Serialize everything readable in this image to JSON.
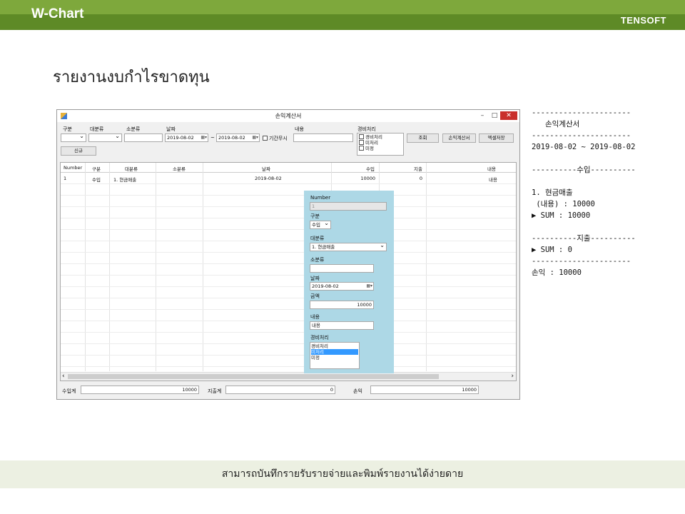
{
  "header": {
    "brand": "W-Chart",
    "company": "TENSOFT"
  },
  "page_title": "รายงานงบกำไรขาดทุน",
  "footer_text": "สามารถบันทึกรายรับรายจ่ายและพิมพ์รายงานได้ง่ายดาย",
  "window": {
    "title": "손익계산서",
    "minimize": "–",
    "maximize": "□",
    "close": "✕",
    "filters": {
      "type_label": "구분",
      "major_label": "대분류",
      "minor_label": "소분류",
      "date_label": "날짜",
      "date_from": "2019-08-02",
      "tilde": "~",
      "date_to": "2019-08-02",
      "ignore_period_label": "기간무시",
      "memo_label": "내용",
      "expense_label": "경비처리",
      "expense_options": [
        "경비처리",
        "미처리",
        "미정"
      ]
    },
    "buttons": {
      "new": "신규",
      "search": "조회",
      "income_statement": "손익계산서",
      "excel_save": "엑셀저장"
    },
    "grid": {
      "columns": [
        "Number",
        "구분",
        "대분류",
        "소분류",
        "날짜",
        "수입",
        "지출",
        "내용"
      ],
      "rows": [
        {
          "number": "1",
          "type": "수입",
          "major": "1. 현금매출",
          "minor": "",
          "date": "2019-08-02",
          "income": "10000",
          "expense": "0",
          "memo": "내용"
        }
      ],
      "scroll_left": "‹",
      "scroll_right": "›"
    },
    "totals": {
      "income_label": "수입계",
      "income_value": "10000",
      "expense_label": "지출계",
      "expense_value": "0",
      "profit_label": "손익",
      "profit_value": "10000"
    }
  },
  "dialog": {
    "number_label": "Number",
    "number_value": "1",
    "type_label": "구분",
    "type_value": "수입",
    "major_label": "대분류",
    "major_value": "1. 현금매출",
    "minor_label": "소분류",
    "minor_value": "",
    "date_label": "날짜",
    "date_value": "2019-08-02",
    "amount_label": "금액",
    "amount_value": "10000",
    "memo_label": "내용",
    "memo_value": "내용",
    "expense_label": "경비처리",
    "expense_options": [
      "경비처리",
      "미처리",
      "미정"
    ],
    "expense_selected": "미처리",
    "colors": {
      "background": "#add8e6",
      "selection": "#3399ff"
    }
  },
  "report": {
    "line1": "----------------------",
    "title": "   손익계산서",
    "line2": "----------------------",
    "period": "2019-08-02 ~ 2019-08-02",
    "income_header": "----------수입----------",
    "income_item": "1. 현금매출",
    "income_detail": " (내용) : 10000",
    "income_sum": "▶ SUM : 10000",
    "expense_header": "----------지출----------",
    "expense_sum": "▶ SUM : 0",
    "line3": "----------------------",
    "profit": "손익 : 10000"
  }
}
